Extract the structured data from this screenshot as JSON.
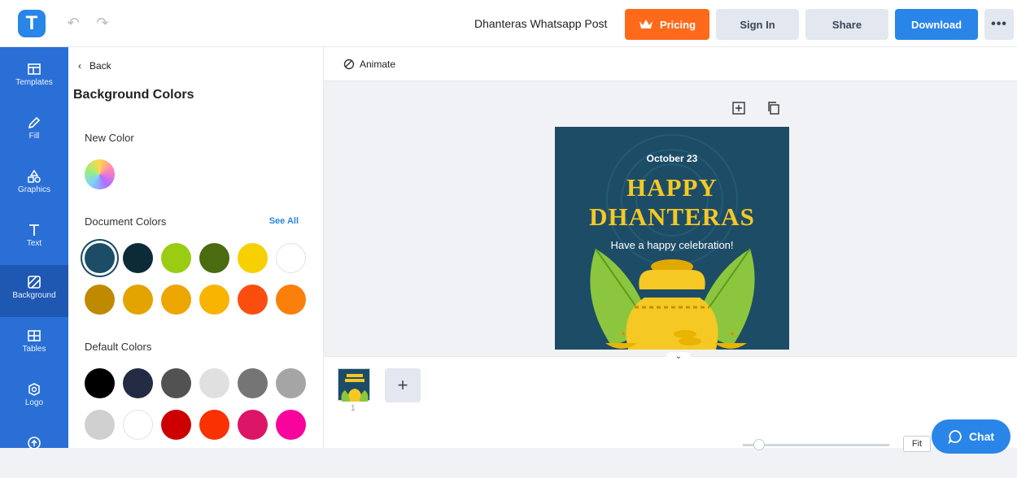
{
  "header": {
    "logo_letter": "T",
    "document_title": "Dhanteras Whatsapp Post",
    "pricing_label": "Pricing",
    "signin_label": "Sign In",
    "share_label": "Share",
    "download_label": "Download",
    "more_label": "•••"
  },
  "rail": {
    "items": [
      {
        "label": "Templates"
      },
      {
        "label": "Fill"
      },
      {
        "label": "Graphics"
      },
      {
        "label": "Text"
      },
      {
        "label": "Background"
      },
      {
        "label": "Tables"
      },
      {
        "label": "Logo"
      }
    ]
  },
  "panel": {
    "back_label": "Back",
    "title": "Background Colors",
    "new_color_label": "New Color",
    "document_colors_label": "Document Colors",
    "see_all_label": "See All",
    "default_colors_label": "Default Colors",
    "document_colors": [
      "#1d4d66",
      "#0d2a38",
      "#99cc12",
      "#4a6b10",
      "#f7d000",
      "#ffffff",
      "#bf8a00",
      "#e3a400",
      "#eda600",
      "#f8b400",
      "#fa4d0e",
      "#fb7f0b"
    ],
    "default_colors": [
      "#000000",
      "#232b45",
      "#525252",
      "#e0e0e0",
      "#757575",
      "#a5a5a5",
      "#d0d0d0",
      "#ffffff",
      "#cc0000",
      "#fa3100",
      "#dd1566",
      "#f8039c"
    ]
  },
  "canvas": {
    "animate_label": "Animate",
    "page_number": "1",
    "fit_label": "Fit"
  },
  "post": {
    "date": "October 23",
    "title_line1": "HAPPY",
    "title_line2": "DHANTERAS",
    "subtitle": "Have a happy celebration!"
  },
  "chat_label": "Chat"
}
